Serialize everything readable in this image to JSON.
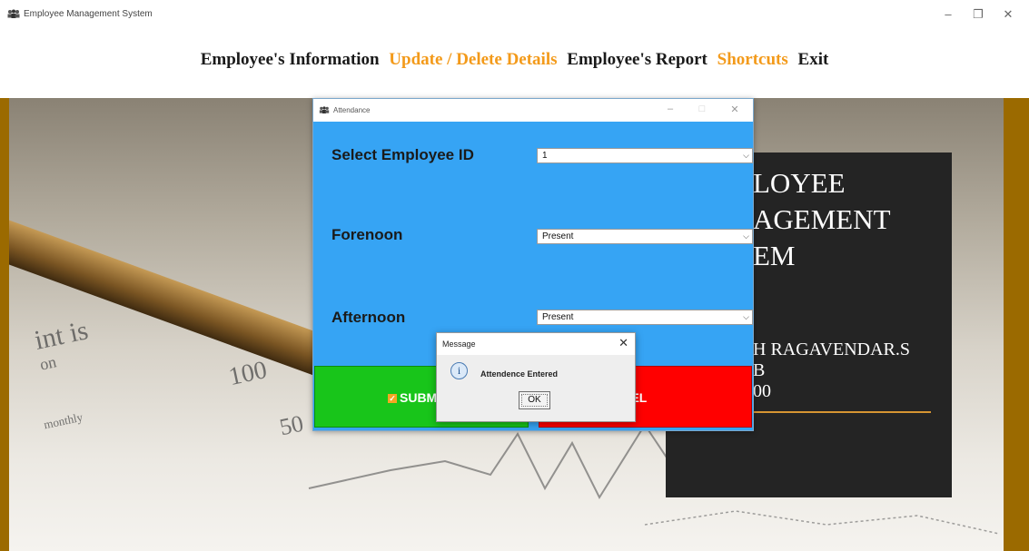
{
  "app": {
    "title": "Employee Management System",
    "icon": "people-icon",
    "controls": {
      "minimize": "–",
      "restore": "❐",
      "close": "✕"
    }
  },
  "menu": {
    "items": [
      {
        "label": "Employee's Information",
        "color": "#1a1a1a"
      },
      {
        "label": "Update / Delete Details",
        "color": "#f39a1a"
      },
      {
        "label": "Employee's Report",
        "color": "#1a1a1a"
      },
      {
        "label": "Shortcuts",
        "color": "#f39a1a"
      },
      {
        "label": "Exit",
        "color": "#1a1a1a"
      }
    ]
  },
  "background": {
    "texts": [
      "int is",
      "on",
      "100",
      "50",
      "monthly"
    ]
  },
  "card": {
    "lines": [
      "LOYEE",
      "AGEMENT",
      "EM"
    ],
    "credit": [
      "H RAGAVENDAR.S",
      "B",
      "00"
    ]
  },
  "attendance": {
    "title": "Attendance",
    "controls": {
      "minimize": "–",
      "maximize": "□",
      "close": "✕"
    },
    "fields": [
      {
        "label": "Select Employee ID",
        "value": "1"
      },
      {
        "label": "Forenoon",
        "value": "Present"
      },
      {
        "label": "Afternoon",
        "value": "Present"
      }
    ],
    "submit_label": "SUBMIT",
    "cancel_label": "CANCEL"
  },
  "message": {
    "title": "Message",
    "text": "Attendence Entered",
    "ok_label": "OK",
    "close": "✕"
  }
}
